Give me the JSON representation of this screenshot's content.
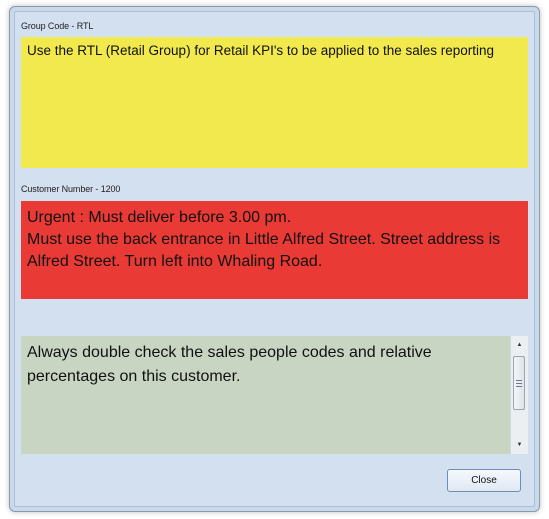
{
  "group": {
    "caption": "Group Code - RTL",
    "note": "Use the RTL (Retail Group) for Retail KPI's to be applied to the sales reporting",
    "color": "#f1e94e"
  },
  "customer": {
    "caption": "Customer Number - 1200",
    "lines": [
      "Urgent : Must deliver before 3.00 pm.",
      "Must use the back entrance in Little Alfred Street. Street address is Alfred Street.  Turn left into Whaling Road."
    ],
    "color": "#ea3a35"
  },
  "extra_note": {
    "text": "Always double check the sales people codes and relative percentages on this customer.",
    "color": "#c7d5c2",
    "scroll_up_icon": "triangle-up",
    "scroll_down_icon": "triangle-down"
  },
  "close_button": {
    "label": "Close"
  }
}
